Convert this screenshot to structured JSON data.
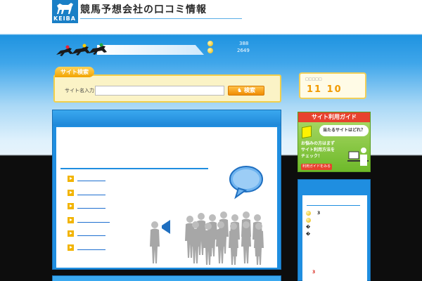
{
  "header": {
    "logo_text": "KEIBA",
    "site_title": "競馬予想会社の口コミ情報"
  },
  "counters": [
    {
      "value": "388"
    },
    {
      "value": "2649"
    }
  ],
  "search": {
    "tab_label": "サイト検索",
    "field_label": "サイト名入力",
    "input_value": "",
    "button_label": "検索"
  },
  "date_box": {
    "small_label": "□□□□□",
    "month": "11",
    "day": "10"
  },
  "main_list": {
    "items": [
      {
        "label": ""
      },
      {
        "label": ""
      },
      {
        "label": ""
      },
      {
        "label": ""
      },
      {
        "label": ""
      },
      {
        "label": ""
      }
    ]
  },
  "guide": {
    "title": "サイト利用ガイド",
    "question": "当たるサイトはどれ？",
    "text_line1": "お悩みの方はまず",
    "text_line2": "サイト利用方法を",
    "text_line3": "チェック！",
    "button_label": "利用ガイドをみる"
  },
  "ranking": {
    "rows": [
      {
        "symbol": "",
        "value": "3"
      },
      {
        "symbol": "",
        "value": ""
      },
      {
        "symbol": "�",
        "value": ""
      },
      {
        "symbol": "�",
        "value": ""
      }
    ],
    "bottom_value": "3"
  },
  "colors": {
    "brand_blue": "#1f8ee0",
    "accent_orange": "#f08c00",
    "accent_yellow": "#f2b400",
    "guide_green": "#6eb92a",
    "guide_red": "#e8422e"
  }
}
